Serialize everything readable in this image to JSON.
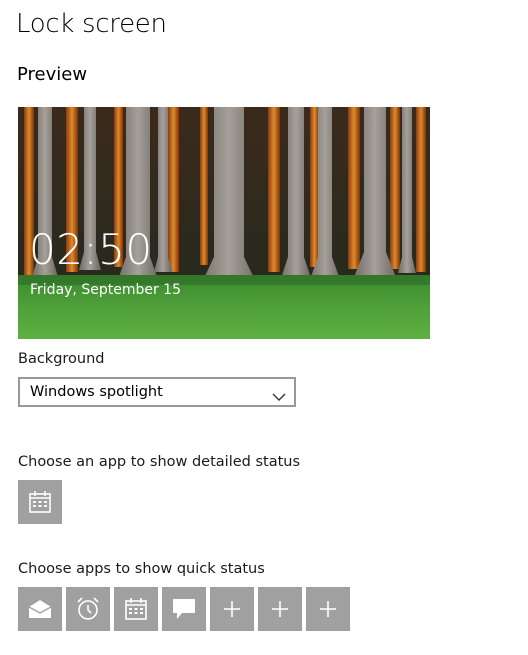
{
  "page": {
    "title": "Lock screen"
  },
  "preview": {
    "heading": "Preview",
    "time": "02:50",
    "date": "Friday, September 15"
  },
  "background": {
    "label": "Background",
    "selected": "Windows spotlight"
  },
  "detailed_status": {
    "label": "Choose an app to show detailed status",
    "app_icon": "calendar-icon"
  },
  "quick_status": {
    "label": "Choose apps to show quick status",
    "app_icons": [
      "mail-icon",
      "alarm-icon",
      "calendar-icon",
      "message-icon",
      "add-icon",
      "add-icon",
      "add-icon"
    ]
  },
  "colors": {
    "tile_bg": "#a0a0a0"
  }
}
